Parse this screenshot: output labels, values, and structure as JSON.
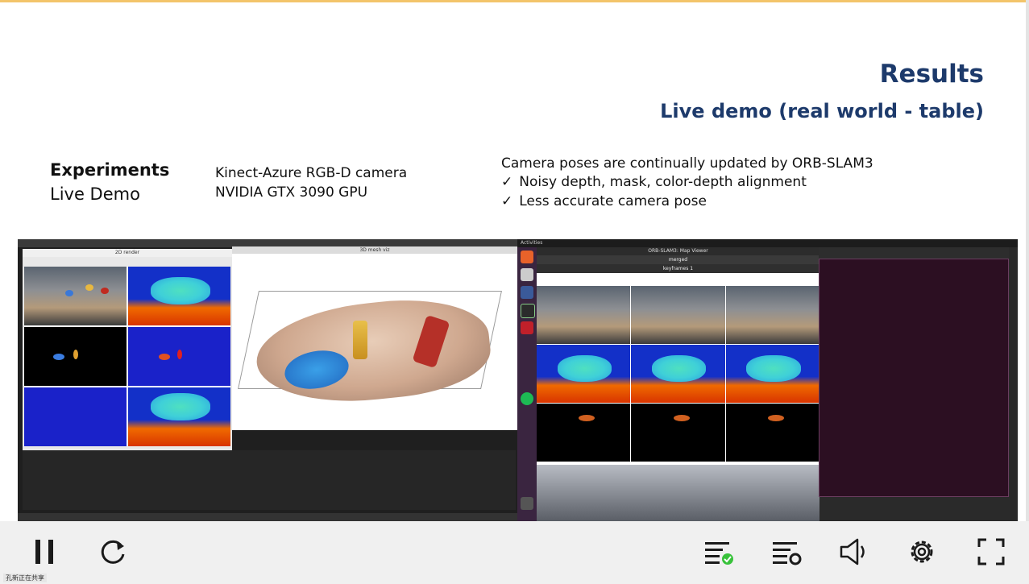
{
  "slide": {
    "title": "Results",
    "subtitle": "Live demo (real world - table)",
    "experiments_heading": "Experiments",
    "experiments_sub": "Live Demo",
    "hardware": [
      "Kinect-Azure RGB-D camera",
      "NVIDIA GTX 3090 GPU"
    ],
    "camera_note": "Camera poses are continually updated by ORB-SLAM3",
    "check_mark": "✓",
    "checks": [
      "Noisy depth, mask, color-depth alignment",
      "Less accurate camera pose"
    ]
  },
  "demo": {
    "window_2d_title": "2D render",
    "window_mesh_title": "3D mesh viz",
    "map_viewer_title": "ORB-SLAM3: Map Viewer",
    "merged_label": "merged",
    "keyframes_label": "keyframes 1",
    "activities": "Activities"
  },
  "player": {
    "caption": "孔新正在共享",
    "colors": {
      "accent": "#1d3a6b",
      "progress_top": "#f3c46a",
      "icon": "#1a1a1a",
      "check_badge": "#38c23b"
    }
  }
}
